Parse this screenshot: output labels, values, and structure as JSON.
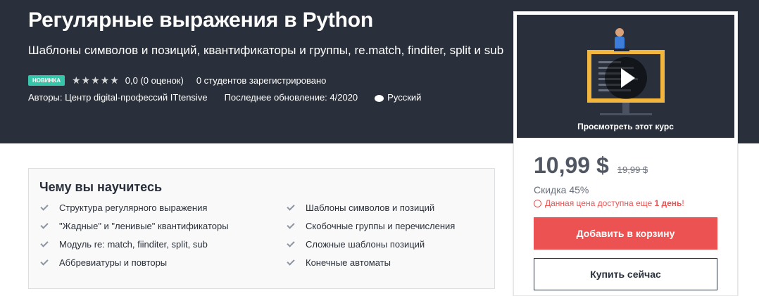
{
  "course": {
    "title": "Регулярные выражения в Python",
    "subtitle": "Шаблоны символов и позиций, квантификаторы и группы, re.match, finditer, split и sub",
    "badge": "НОВИНКА",
    "rating_text": "0,0 (0 оценок)",
    "students": "0 студентов зарегистрировано",
    "authors": "Авторы: Центр digital-профессий ITtensive",
    "updated": "Последнее обновление: 4/2020",
    "language": "Русский",
    "stars": 0
  },
  "sidebar": {
    "preview_caption": "Просмотреть этот курс",
    "price": "10,99 $",
    "old_price": "19,99 $",
    "discount": "Скидка 45%",
    "timer_prefix": "Данная цена доступна еще ",
    "timer_bold": "1 день",
    "timer_suffix": "!",
    "add_to_cart": "Добавить в корзину",
    "buy_now": "Купить сейчас"
  },
  "learn": {
    "title": "Чему вы научитесь",
    "items": [
      "Структура регулярного выражения",
      "Шаблоны символов и позиций",
      "\"Жадные\" и \"ленивые\" квантификаторы",
      "Скобочные группы и перечисления",
      "Модуль re: match, fiinditer, split, sub",
      "Сложные шаблоны позиций",
      "Аббревиатуры и повторы",
      "Конечные автоматы"
    ]
  },
  "colors": {
    "hero_bg": "#29303b",
    "accent_red": "#ec5252",
    "badge_green": "#36c6a9"
  }
}
